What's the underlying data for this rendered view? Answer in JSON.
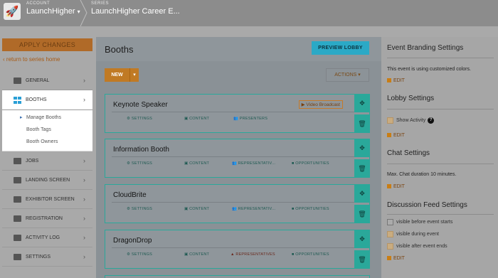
{
  "header": {
    "account_label": "ACCOUNT",
    "account_name": "LaunchHigher",
    "series_label": "SERIES",
    "series_name": "LaunchHigher Career E..."
  },
  "sidebar": {
    "apply_label": "APPLY CHANGES",
    "return_label": "return to series home",
    "items": [
      {
        "label": "GENERAL",
        "icon": "info-icon"
      },
      {
        "label": "BOOTHS",
        "icon": "grid-icon",
        "active": true
      },
      {
        "label": "JOBS",
        "icon": "briefcase-icon"
      },
      {
        "label": "LANDING SCREEN",
        "icon": "image-icon"
      },
      {
        "label": "EXHIBITOR SCREEN",
        "icon": "image-icon"
      },
      {
        "label": "REGISTRATION",
        "icon": "form-icon"
      },
      {
        "label": "ACTIVITY LOG",
        "icon": "arrows-icon"
      },
      {
        "label": "SETTINGS",
        "icon": "gear-icon"
      }
    ],
    "sub_items": [
      "Manage Booths",
      "Booth Tags",
      "Booth Owners"
    ]
  },
  "main": {
    "title": "Booths",
    "preview_label": "PREVIEW LOBBY",
    "new_label": "NEW",
    "actions_label": "ACTIONS",
    "booths": [
      {
        "name": "Keynote Speaker",
        "tag": "Video Broadcast",
        "links": [
          "SETTINGS",
          "CONTENT",
          "PRESENTERS"
        ]
      },
      {
        "name": "Information Booth",
        "links": [
          "SETTINGS",
          "CONTENT",
          "REPRESENTATIV...",
          "OPPORTUNITIES"
        ]
      },
      {
        "name": "CloudBrite",
        "links": [
          "SETTINGS",
          "CONTENT",
          "REPRESENTATIV...",
          "OPPORTUNITIES"
        ]
      },
      {
        "name": "DragonDrop",
        "links": [
          "SETTINGS",
          "CONTENT",
          "REPRESENTATIVES",
          "OPPORTUNITIES"
        ]
      }
    ]
  },
  "right": {
    "branding_title": "Event Branding Settings",
    "branding_text": "This event is using customized colors.",
    "edit_label": "EDIT",
    "lobby_title": "Lobby Settings",
    "show_activity": "Show Activity",
    "chat_title": "Chat Settings",
    "chat_text": "Max. Chat duration 10 minutes.",
    "feed_title": "Discussion Feed Settings",
    "feed_before": "visible before event starts",
    "feed_during": "visible during event",
    "feed_after": "visible after event ends"
  },
  "colors": {
    "teal": "#2aa89a",
    "orange": "#c07a24",
    "blue": "#2ba9c6"
  }
}
